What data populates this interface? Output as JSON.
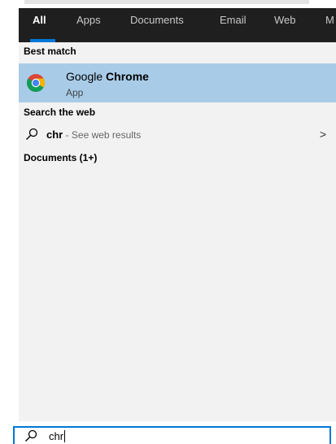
{
  "tabs": [
    {
      "label": "All",
      "active": true
    },
    {
      "label": "Apps"
    },
    {
      "label": "Documents"
    },
    {
      "label": "Email"
    },
    {
      "label": "Web"
    },
    {
      "label": "M"
    }
  ],
  "sections": {
    "best_match": "Best match",
    "search_web": "Search the web",
    "documents": "Documents (1+)"
  },
  "best_match_item": {
    "name_prefix": "Google ",
    "name_bold": "Chrome",
    "type": "App",
    "icon": "chrome-icon"
  },
  "web_result": {
    "query": "chr",
    "suffix": " - See web results",
    "chevron": ">"
  },
  "search": {
    "value": "chr"
  },
  "colors": {
    "tab_bar": "#1f1f1f",
    "accent": "#0078d7",
    "highlight": "#a8cce8",
    "panel": "#f2f2f2"
  }
}
